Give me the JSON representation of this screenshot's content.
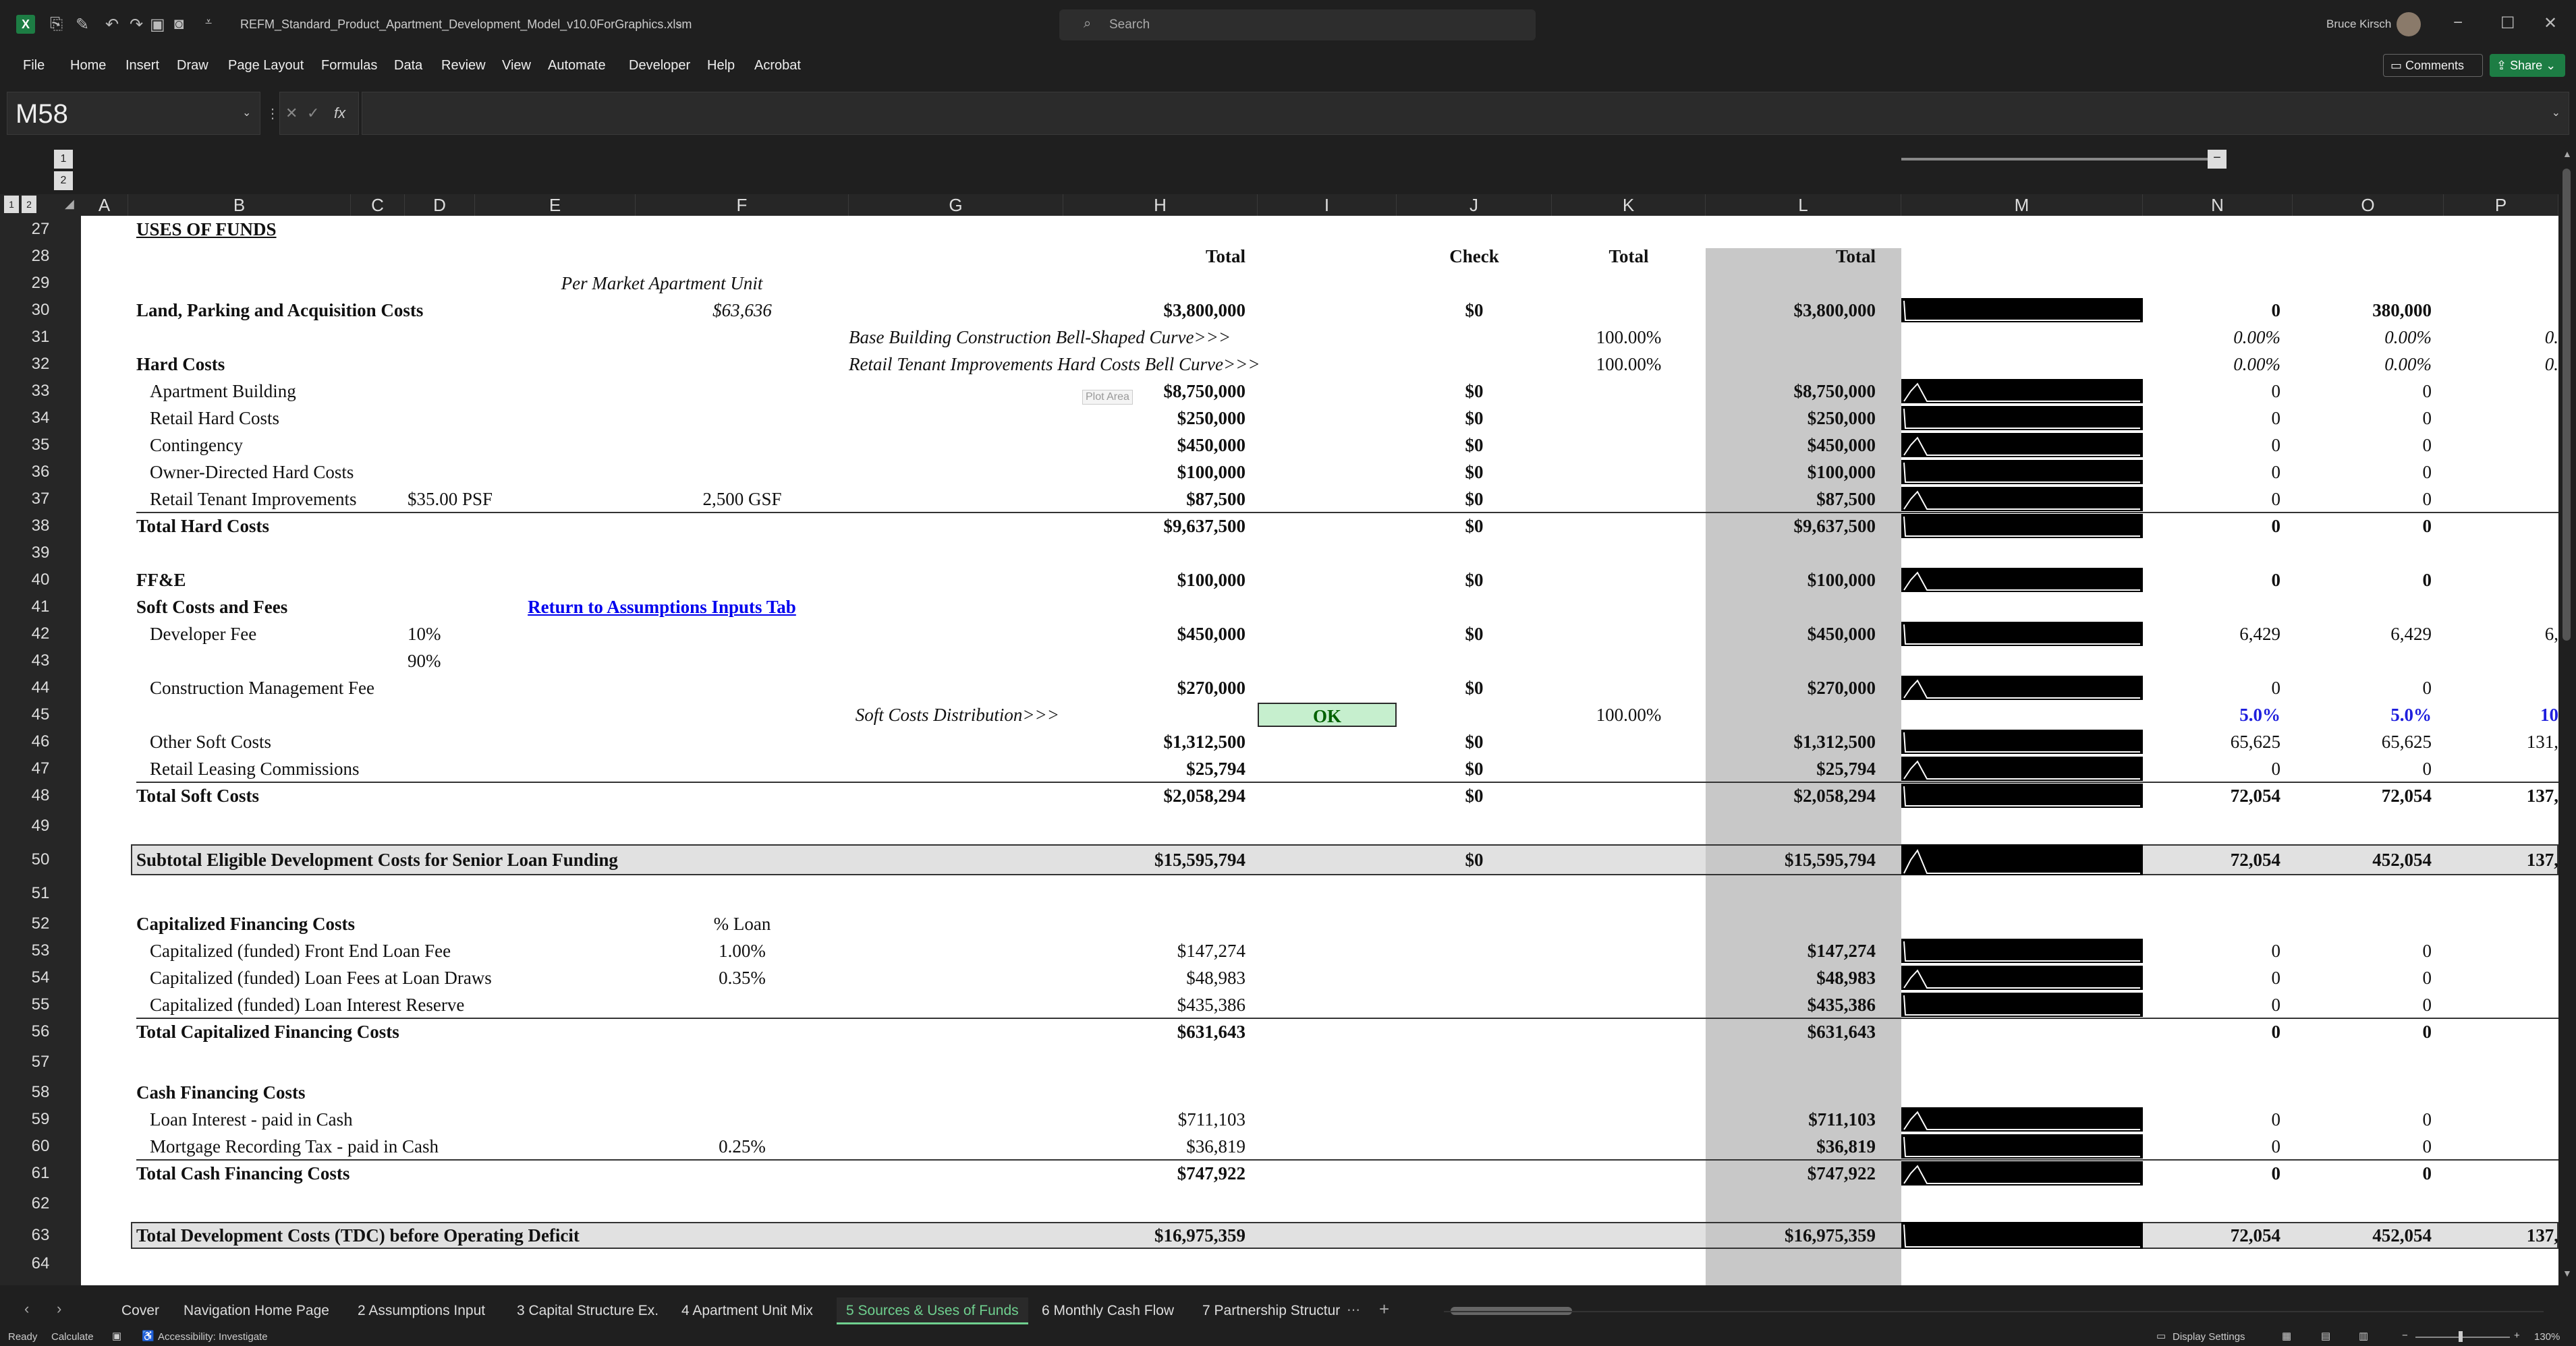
{
  "app": {
    "file_name": "REFM_Standard_Product_Apartment_Development_Model_v10.0ForGraphics.xlsm",
    "search_placeholder": "Search",
    "user_name": "Bruce Kirsch"
  },
  "menu": [
    "File",
    "Home",
    "Insert",
    "Draw",
    "Page Layout",
    "Formulas",
    "Data",
    "Review",
    "View",
    "Automate",
    "Developer",
    "Help",
    "Acrobat"
  ],
  "ribbon_buttons": {
    "comments": "Comments",
    "share": "Share"
  },
  "formula_bar": {
    "name_box": "M58",
    "fx": "fx",
    "formula": ""
  },
  "outline": {
    "levels": [
      "1",
      "2"
    ]
  },
  "columns": [
    "A",
    "B",
    "C",
    "D",
    "E",
    "F",
    "G",
    "H",
    "I",
    "J",
    "K",
    "L",
    "M",
    "N",
    "O",
    "P"
  ],
  "rows": [
    {
      "n": "27",
      "cells": [
        {
          "col": "B",
          "text": "USES OF FUNDS",
          "style": "b u"
        }
      ]
    },
    {
      "n": "28",
      "cells": [
        {
          "col": "H",
          "text": "Total",
          "style": "b"
        },
        {
          "col": "J",
          "text": "Check",
          "style": "b"
        },
        {
          "col": "K",
          "text": "Total",
          "style": "b"
        },
        {
          "col": "L",
          "text": "Total",
          "style": "b"
        }
      ]
    },
    {
      "n": "29",
      "cells": [
        {
          "col": "EF",
          "text": "Per Market Apartment Unit",
          "style": "i"
        }
      ]
    },
    {
      "n": "30",
      "cells": [
        {
          "col": "B",
          "text": "Land, Parking and Acquisition Costs",
          "style": "b"
        },
        {
          "col": "F",
          "text": "$63,636",
          "style": "i"
        },
        {
          "col": "H",
          "text": "$3,800,000",
          "style": "b"
        },
        {
          "col": "J",
          "text": "$0",
          "style": "b"
        },
        {
          "col": "L",
          "text": "$3,800,000",
          "style": "b"
        },
        {
          "col": "N",
          "text": "0",
          "style": "b"
        },
        {
          "col": "O",
          "text": "380,000",
          "style": "b"
        }
      ]
    },
    {
      "n": "31",
      "cells": [
        {
          "col": "G",
          "text": "Base Building Construction Bell-Shaped Curve>>>",
          "style": "i"
        },
        {
          "col": "K",
          "text": "100.00%"
        },
        {
          "col": "N",
          "text": "0.00%",
          "style": "i"
        },
        {
          "col": "O",
          "text": "0.00%",
          "style": "i"
        },
        {
          "col": "P",
          "text": "0.",
          "style": "i"
        }
      ]
    },
    {
      "n": "32",
      "cells": [
        {
          "col": "B",
          "text": "Hard Costs",
          "style": "b"
        },
        {
          "col": "G",
          "text": "Retail Tenant Improvements Hard Costs Bell Curve>>>",
          "style": "i"
        },
        {
          "col": "K",
          "text": "100.00%"
        },
        {
          "col": "N",
          "text": "0.00%",
          "style": "i"
        },
        {
          "col": "O",
          "text": "0.00%",
          "style": "i"
        },
        {
          "col": "P",
          "text": "0.",
          "style": "i"
        }
      ]
    },
    {
      "n": "33",
      "cells": [
        {
          "col": "B2",
          "text": "Apartment Building"
        },
        {
          "col": "H",
          "text": "$8,750,000",
          "style": "b"
        },
        {
          "col": "J",
          "text": "$0",
          "style": "b"
        },
        {
          "col": "L",
          "text": "$8,750,000",
          "style": "b"
        },
        {
          "col": "N",
          "text": "0"
        },
        {
          "col": "O",
          "text": "0"
        }
      ]
    },
    {
      "n": "34",
      "cells": [
        {
          "col": "B2",
          "text": "Retail Hard Costs"
        },
        {
          "col": "H",
          "text": "$250,000",
          "style": "b"
        },
        {
          "col": "J",
          "text": "$0",
          "style": "b"
        },
        {
          "col": "L",
          "text": "$250,000",
          "style": "b"
        },
        {
          "col": "N",
          "text": "0"
        },
        {
          "col": "O",
          "text": "0"
        }
      ]
    },
    {
      "n": "35",
      "cells": [
        {
          "col": "B2",
          "text": "Contingency"
        },
        {
          "col": "H",
          "text": "$450,000",
          "style": "b"
        },
        {
          "col": "J",
          "text": "$0",
          "style": "b"
        },
        {
          "col": "L",
          "text": "$450,000",
          "style": "b"
        },
        {
          "col": "N",
          "text": "0"
        },
        {
          "col": "O",
          "text": "0"
        }
      ]
    },
    {
      "n": "36",
      "cells": [
        {
          "col": "B2",
          "text": "Owner-Directed Hard Costs"
        },
        {
          "col": "H",
          "text": "$100,000",
          "style": "b"
        },
        {
          "col": "J",
          "text": "$0",
          "style": "b"
        },
        {
          "col": "L",
          "text": "$100,000",
          "style": "b"
        },
        {
          "col": "N",
          "text": "0"
        },
        {
          "col": "O",
          "text": "0"
        }
      ]
    },
    {
      "n": "37",
      "cells": [
        {
          "col": "B2",
          "text": "Retail Tenant Improvements"
        },
        {
          "col": "D",
          "text": "$35.00 PSF"
        },
        {
          "col": "F",
          "text": "2,500 GSF"
        },
        {
          "col": "H",
          "text": "$87,500",
          "style": "b"
        },
        {
          "col": "J",
          "text": "$0",
          "style": "b"
        },
        {
          "col": "L",
          "text": "$87,500",
          "style": "b"
        },
        {
          "col": "N",
          "text": "0"
        },
        {
          "col": "O",
          "text": "0"
        }
      ]
    },
    {
      "n": "38",
      "cells": [
        {
          "col": "B",
          "text": "Total Hard Costs",
          "style": "b"
        },
        {
          "col": "H",
          "text": "$9,637,500",
          "style": "b"
        },
        {
          "col": "J",
          "text": "$0",
          "style": "b"
        },
        {
          "col": "L",
          "text": "$9,637,500",
          "style": "b"
        },
        {
          "col": "N",
          "text": "0",
          "style": "b"
        },
        {
          "col": "O",
          "text": "0",
          "style": "b"
        }
      ]
    },
    {
      "n": "39",
      "cells": []
    },
    {
      "n": "40",
      "cells": [
        {
          "col": "B",
          "text": "FF&E",
          "style": "b"
        },
        {
          "col": "H",
          "text": "$100,000",
          "style": "b"
        },
        {
          "col": "J",
          "text": "$0",
          "style": "b"
        },
        {
          "col": "L",
          "text": "$100,000",
          "style": "b"
        },
        {
          "col": "N",
          "text": "0",
          "style": "b"
        },
        {
          "col": "O",
          "text": "0",
          "style": "b"
        }
      ]
    },
    {
      "n": "41",
      "cells": [
        {
          "col": "B",
          "text": "Soft Costs and Fees",
          "style": "b"
        },
        {
          "col": "EF",
          "text": "Return to Assumptions Inputs Tab",
          "style": "link"
        }
      ]
    },
    {
      "n": "42",
      "cells": [
        {
          "col": "B2",
          "text": "Developer Fee"
        },
        {
          "col": "D",
          "text": "10%"
        },
        {
          "col": "H",
          "text": "$450,000",
          "style": "b"
        },
        {
          "col": "J",
          "text": "$0",
          "style": "b"
        },
        {
          "col": "L",
          "text": "$450,000",
          "style": "b"
        },
        {
          "col": "N",
          "text": "6,429"
        },
        {
          "col": "O",
          "text": "6,429"
        },
        {
          "col": "P",
          "text": "6,"
        }
      ]
    },
    {
      "n": "43",
      "cells": [
        {
          "col": "D",
          "text": "90%"
        }
      ]
    },
    {
      "n": "44",
      "cells": [
        {
          "col": "B2",
          "text": "Construction Management Fee"
        },
        {
          "col": "H",
          "text": "$270,000",
          "style": "b"
        },
        {
          "col": "J",
          "text": "$0",
          "style": "b"
        },
        {
          "col": "L",
          "text": "$270,000",
          "style": "b"
        },
        {
          "col": "N",
          "text": "0"
        },
        {
          "col": "O",
          "text": "0"
        }
      ]
    },
    {
      "n": "45",
      "cells": [
        {
          "col": "G",
          "text": "Soft Costs Distribution>>>",
          "style": "i"
        },
        {
          "col": "I",
          "text": "OK",
          "style": "ok"
        },
        {
          "col": "K",
          "text": "100.00%"
        },
        {
          "col": "N",
          "text": "5.0%",
          "style": "b blue"
        },
        {
          "col": "O",
          "text": "5.0%",
          "style": "b blue"
        },
        {
          "col": "P",
          "text": "10",
          "style": "b blue"
        }
      ]
    },
    {
      "n": "46",
      "cells": [
        {
          "col": "B2",
          "text": "Other Soft Costs"
        },
        {
          "col": "H",
          "text": "$1,312,500",
          "style": "b"
        },
        {
          "col": "J",
          "text": "$0",
          "style": "b"
        },
        {
          "col": "L",
          "text": "$1,312,500",
          "style": "b"
        },
        {
          "col": "N",
          "text": "65,625"
        },
        {
          "col": "O",
          "text": "65,625"
        },
        {
          "col": "P",
          "text": "131,"
        }
      ]
    },
    {
      "n": "47",
      "cells": [
        {
          "col": "B2",
          "text": "Retail Leasing Commissions"
        },
        {
          "col": "H",
          "text": "$25,794",
          "style": "b"
        },
        {
          "col": "J",
          "text": "$0",
          "style": "b"
        },
        {
          "col": "L",
          "text": "$25,794",
          "style": "b"
        },
        {
          "col": "N",
          "text": "0"
        },
        {
          "col": "O",
          "text": "0"
        }
      ]
    },
    {
      "n": "48",
      "cells": [
        {
          "col": "B",
          "text": "Total Soft Costs",
          "style": "b"
        },
        {
          "col": "H",
          "text": "$2,058,294",
          "style": "b"
        },
        {
          "col": "J",
          "text": "$0",
          "style": "b"
        },
        {
          "col": "L",
          "text": "$2,058,294",
          "style": "b"
        },
        {
          "col": "N",
          "text": "72,054",
          "style": "b"
        },
        {
          "col": "O",
          "text": "72,054",
          "style": "b"
        },
        {
          "col": "P",
          "text": "137,",
          "style": "b"
        }
      ]
    },
    {
      "n": "49",
      "cells": []
    },
    {
      "n": "50",
      "cells": [
        {
          "col": "B",
          "text": "Subtotal Eligible Development Costs for Senior Loan Funding",
          "style": "b"
        },
        {
          "col": "H",
          "text": "$15,595,794",
          "style": "b"
        },
        {
          "col": "J",
          "text": "$0",
          "style": "b"
        },
        {
          "col": "L",
          "text": "$15,595,794",
          "style": "b"
        },
        {
          "col": "N",
          "text": "72,054",
          "style": "b"
        },
        {
          "col": "O",
          "text": "452,054",
          "style": "b"
        },
        {
          "col": "P",
          "text": "137,",
          "style": "b"
        }
      ]
    },
    {
      "n": "51",
      "cells": []
    },
    {
      "n": "52",
      "cells": [
        {
          "col": "B",
          "text": "Capitalized Financing Costs",
          "style": "b"
        },
        {
          "col": "F",
          "text": "% Loan"
        }
      ]
    },
    {
      "n": "53",
      "cells": [
        {
          "col": "B2",
          "text": "Capitalized (funded) Front End Loan Fee"
        },
        {
          "col": "F",
          "text": "1.00%"
        },
        {
          "col": "H",
          "text": "$147,274"
        },
        {
          "col": "L",
          "text": "$147,274",
          "style": "b"
        },
        {
          "col": "N",
          "text": "0"
        },
        {
          "col": "O",
          "text": "0"
        }
      ]
    },
    {
      "n": "54",
      "cells": [
        {
          "col": "B2",
          "text": "Capitalized (funded) Loan Fees at Loan Draws"
        },
        {
          "col": "F",
          "text": "0.35%"
        },
        {
          "col": "H",
          "text": "$48,983"
        },
        {
          "col": "L",
          "text": "$48,983",
          "style": "b"
        },
        {
          "col": "N",
          "text": "0"
        },
        {
          "col": "O",
          "text": "0"
        }
      ]
    },
    {
      "n": "55",
      "cells": [
        {
          "col": "B2",
          "text": "Capitalized (funded) Loan Interest Reserve"
        },
        {
          "col": "H",
          "text": "$435,386"
        },
        {
          "col": "L",
          "text": "$435,386",
          "style": "b"
        },
        {
          "col": "N",
          "text": "0"
        },
        {
          "col": "O",
          "text": "0"
        }
      ]
    },
    {
      "n": "56",
      "cells": [
        {
          "col": "B",
          "text": "Total Capitalized Financing Costs",
          "style": "b"
        },
        {
          "col": "H",
          "text": "$631,643",
          "style": "b"
        },
        {
          "col": "L",
          "text": "$631,643",
          "style": "b"
        },
        {
          "col": "N",
          "text": "0",
          "style": "b"
        },
        {
          "col": "O",
          "text": "0",
          "style": "b"
        }
      ]
    },
    {
      "n": "57",
      "cells": []
    },
    {
      "n": "58",
      "cells": [
        {
          "col": "B",
          "text": "Cash Financing Costs",
          "style": "b"
        }
      ]
    },
    {
      "n": "59",
      "cells": [
        {
          "col": "B2",
          "text": "Loan Interest - paid in Cash"
        },
        {
          "col": "H",
          "text": "$711,103"
        },
        {
          "col": "L",
          "text": "$711,103",
          "style": "b"
        },
        {
          "col": "N",
          "text": "0"
        },
        {
          "col": "O",
          "text": "0"
        }
      ]
    },
    {
      "n": "60",
      "cells": [
        {
          "col": "B2",
          "text": "Mortgage Recording Tax - paid in Cash"
        },
        {
          "col": "F",
          "text": "0.25%"
        },
        {
          "col": "H",
          "text": "$36,819"
        },
        {
          "col": "L",
          "text": "$36,819",
          "style": "b"
        },
        {
          "col": "N",
          "text": "0"
        },
        {
          "col": "O",
          "text": "0"
        }
      ]
    },
    {
      "n": "61",
      "cells": [
        {
          "col": "B",
          "text": "Total Cash Financing Costs",
          "style": "b"
        },
        {
          "col": "H",
          "text": "$747,922",
          "style": "b"
        },
        {
          "col": "L",
          "text": "$747,922",
          "style": "b"
        },
        {
          "col": "N",
          "text": "0",
          "style": "b"
        },
        {
          "col": "O",
          "text": "0",
          "style": "b"
        }
      ]
    },
    {
      "n": "62",
      "cells": []
    },
    {
      "n": "63",
      "cells": [
        {
          "col": "B",
          "text": "Total Development Costs (TDC) before Operating Deficit",
          "style": "b"
        },
        {
          "col": "H",
          "text": "$16,975,359",
          "style": "b"
        },
        {
          "col": "L",
          "text": "$16,975,359",
          "style": "b"
        },
        {
          "col": "N",
          "text": "72,054",
          "style": "b"
        },
        {
          "col": "O",
          "text": "452,054",
          "style": "b"
        },
        {
          "col": "P",
          "text": "137,",
          "style": "b"
        }
      ]
    },
    {
      "n": "64",
      "cells": []
    }
  ],
  "plot_area_tooltip": "Plot Area",
  "sheet_tabs": [
    "Cover",
    "Navigation Home Page",
    "2 Assumptions Input",
    "3 Capital Structure Ex.",
    "4 Apartment Unit Mix",
    "5 Sources & Uses of Funds",
    "6 Monthly Cash Flow",
    "7 Partnership Structur"
  ],
  "active_tab": "5 Sources & Uses of Funds",
  "status": {
    "ready": "Ready",
    "calculate": "Calculate",
    "accessibility": "Accessibility: Investigate",
    "display_settings": "Display Settings",
    "zoom": "130%"
  }
}
